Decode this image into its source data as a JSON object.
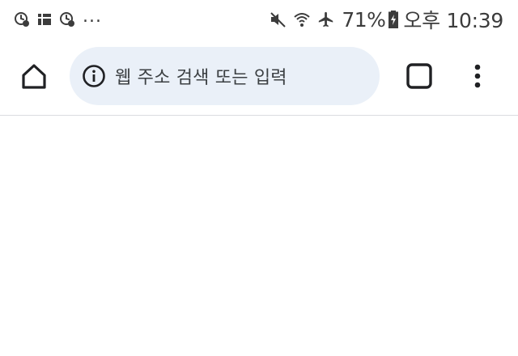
{
  "status_bar": {
    "left_icons": [
      "clock-notification-icon",
      "grid-app-icon",
      "clock-notification-icon"
    ],
    "overflow": "...",
    "right_icons": [
      "mute-icon",
      "wifi-icon",
      "airplane-icon"
    ],
    "battery_percent": "71%",
    "time": "오후 10:39"
  },
  "toolbar": {
    "home_icon": "home-icon",
    "omnibox": {
      "placeholder": "웹 주소 검색 또는 입력",
      "leading_icon": "info-icon"
    },
    "tabs_icon": "tab-switcher-icon",
    "menu_icon": "more-vert-icon"
  },
  "colors": {
    "omnibox_bg": "#eaf0f8",
    "divider": "#dadce0",
    "icon": "#202124",
    "status": "#3c3c3c"
  }
}
